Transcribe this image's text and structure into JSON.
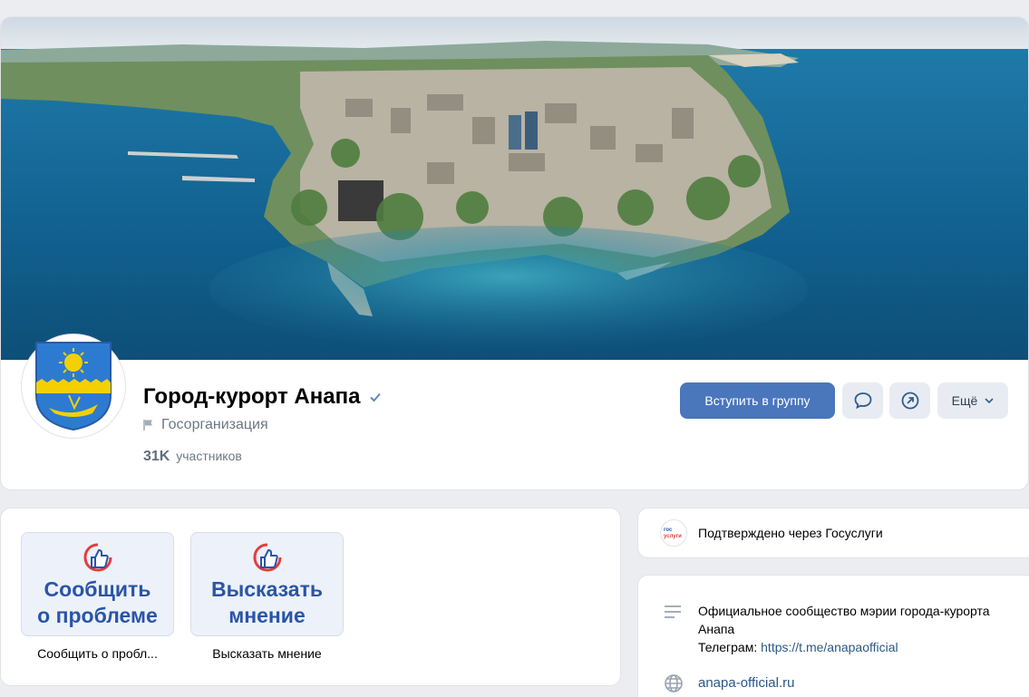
{
  "group": {
    "title": "Город-курорт Анапа",
    "type": "Госорганизация",
    "members_count": "31K",
    "members_label": "участников",
    "verified": true
  },
  "actions": {
    "join_label": "Вступить в группу",
    "message_icon": "message-icon",
    "share_icon": "share-icon",
    "more_label": "Ещё"
  },
  "apps": [
    {
      "tile_text": [
        "Сообщить",
        "о проблеме"
      ],
      "caption": "Сообщить о пробл..."
    },
    {
      "tile_text": [
        "Высказать",
        "мнение"
      ],
      "caption": "Высказать мнение"
    }
  ],
  "gosuslugi": {
    "logo_text": [
      "гос",
      "услуги"
    ],
    "label": "Подтверждено через Госуслуги"
  },
  "info": {
    "description": "Официальное сообщество мэрии города-курорта Анапа",
    "telegram_label": "Телеграм:",
    "telegram_link": "https://t.me/anapaofficial",
    "website": "anapa-official.ru"
  },
  "colors": {
    "accent": "#4a76bc",
    "link": "#2a5885",
    "tile_bg": "#edf1fa",
    "tile_text": "#2a55a6"
  }
}
